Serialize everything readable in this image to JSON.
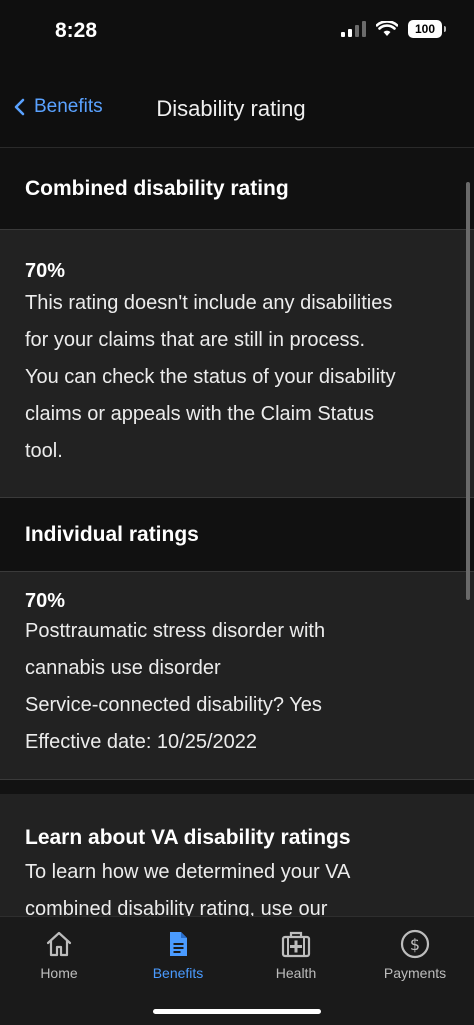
{
  "status_bar": {
    "time": "8:28",
    "battery": "100"
  },
  "navbar": {
    "back_label": "Benefits",
    "title": "Disability rating"
  },
  "combined": {
    "header": "Combined disability rating",
    "value": "70%",
    "description_lines": [
      "This rating doesn't include any disabilities",
      "for your claims that are still in process.",
      "You can check the status of your disability",
      "claims or appeals with the Claim Status",
      "tool."
    ]
  },
  "individual": {
    "header": "Individual ratings",
    "items": [
      {
        "value": "70%",
        "name_lines": [
          "Posttraumatic stress disorder with",
          "cannabis use disorder"
        ],
        "service_connected": "Service-connected disability?  Yes",
        "effective_date": "Effective date:  10/25/2022"
      }
    ]
  },
  "learn": {
    "header": "Learn about VA disability ratings",
    "body_lines": [
      "To learn how we determined your VA",
      "combined disability rating, use our"
    ]
  },
  "tabs": [
    {
      "label": "Home",
      "icon": "home-icon",
      "active": false
    },
    {
      "label": "Benefits",
      "icon": "document-icon",
      "active": true
    },
    {
      "label": "Health",
      "icon": "medkit-icon",
      "active": false
    },
    {
      "label": "Payments",
      "icon": "dollar-icon",
      "active": false
    }
  ],
  "colors": {
    "accent": "#4a9bff",
    "link": "#5aa2ff",
    "background": "#121212",
    "card": "#222222"
  }
}
